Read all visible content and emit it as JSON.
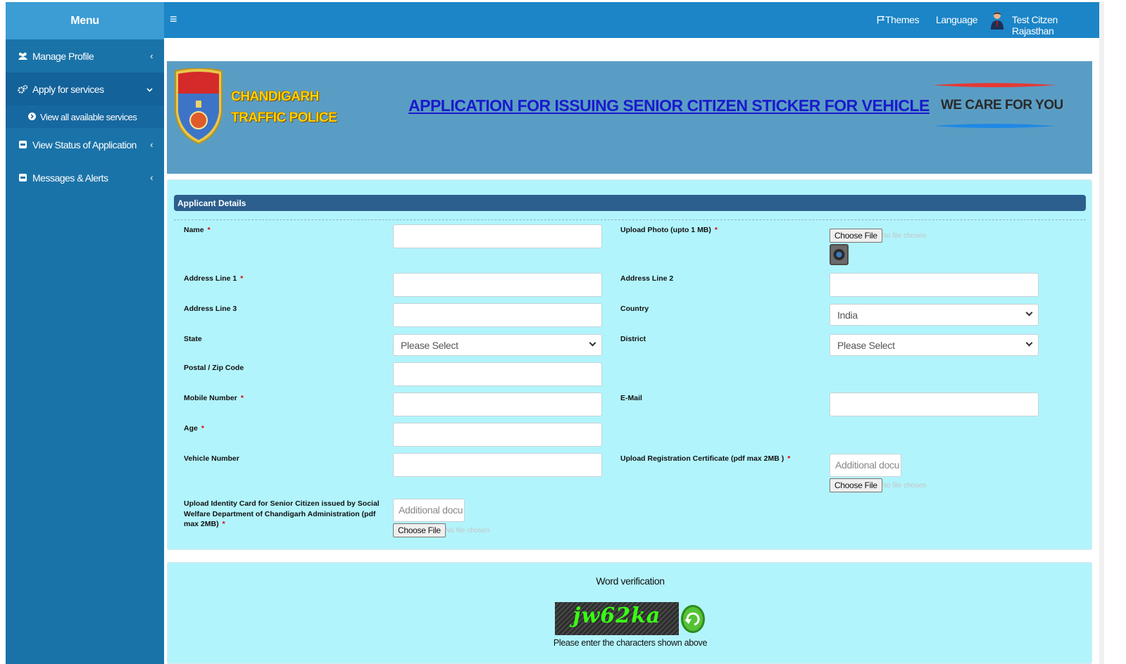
{
  "sidebar": {
    "title": "Menu",
    "items": [
      {
        "label": "Manage Profile",
        "icon": "users-icon"
      },
      {
        "label": "Apply for services",
        "icon": "cogs-icon"
      },
      {
        "label": "View Status of Application",
        "icon": "square-icon"
      },
      {
        "label": "Messages & Alerts",
        "icon": "square-icon"
      }
    ],
    "subitem": {
      "label": "View all available services",
      "icon": "circle-arrow-icon"
    }
  },
  "topbar": {
    "themes_label": "Themes",
    "language_label": "Language",
    "user_name": "Test Citzen Rajasthan"
  },
  "banner": {
    "logo_text_line1": "CHANDIGARH",
    "logo_text_line2": "TRAFFIC POLICE",
    "title": "APPLICATION FOR ISSUING SENIOR CITIZEN STICKER FOR VEHICLE",
    "tagline": "WE CARE FOR YOU"
  },
  "form": {
    "section_title": "Applicant Details",
    "required_mark": "*",
    "labels": {
      "name": "Name",
      "upload_photo": "Upload Photo (upto 1 MB)",
      "address1": "Address Line 1",
      "address2": "Address Line 2",
      "address3": "Address Line 3",
      "country": "Country",
      "state": "State",
      "district": "District",
      "postal": "Postal / Zip Code",
      "mobile": "Mobile Number",
      "email": "E-Mail",
      "age": "Age",
      "vehicle": "Vehicle Number",
      "upload_rc": "Upload Registration Certificate (pdf max 2MB )",
      "upload_id": "Upload Identity Card for Senior Citizen issued by Social Welfare Department of Chandigarh Administration (pdf max 2MB)"
    },
    "country_value": "India",
    "state_placeholder": "Please Select",
    "district_placeholder": "Please Select",
    "choose_file_label": "Choose File",
    "no_file_text": "No file chosen",
    "additional_doc_placeholder": "Additional docu"
  },
  "captcha": {
    "title": "Word verification",
    "code": "jw62ka",
    "hint": "Please enter the characters shown above"
  }
}
